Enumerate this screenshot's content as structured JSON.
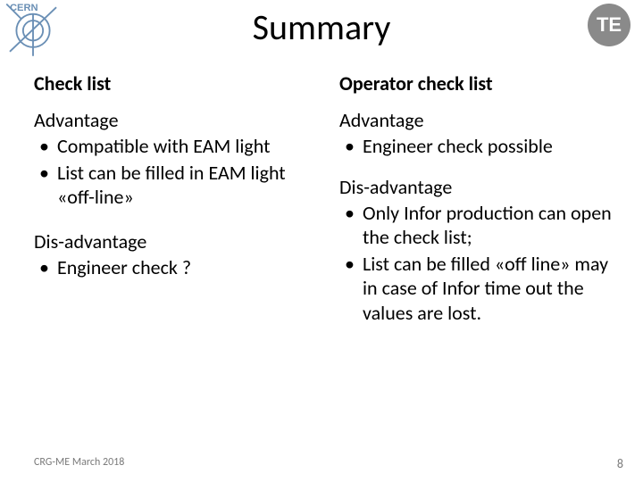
{
  "header": {
    "title": "Summary",
    "logo_right_text": "TE"
  },
  "left": {
    "heading": "Check list",
    "adv_label": "Advantage",
    "adv_items": [
      "Compatible with EAM light",
      "List can be filled in EAM light «off-line»"
    ],
    "dis_label": "Dis-advantage",
    "dis_items": [
      "Engineer check ?"
    ]
  },
  "right": {
    "heading": "Operator check list",
    "adv_label": "Advantage",
    "adv_items": [
      "Engineer check possible"
    ],
    "dis_label": "Dis-advantage",
    "dis_items": [
      "Only Infor production can open the check list;",
      "List can be filled «off line» may in case of Infor time out the values are lost."
    ]
  },
  "footer": {
    "left": "CRG-ME March 2018",
    "page": "8"
  }
}
